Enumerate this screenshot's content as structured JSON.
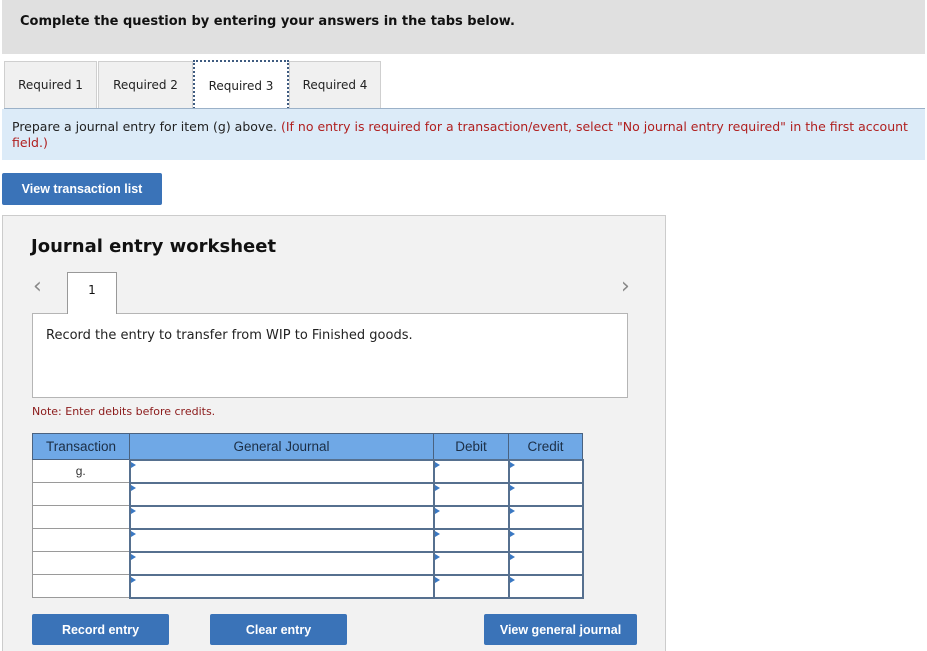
{
  "header": {
    "title": "Complete the question by entering your answers in the tabs below."
  },
  "tabs": [
    {
      "label": "Required 1",
      "active": false
    },
    {
      "label": "Required 2",
      "active": false
    },
    {
      "label": "Required 3",
      "active": true
    },
    {
      "label": "Required 4",
      "active": false
    }
  ],
  "instructions": {
    "main": "Prepare a journal entry for item (g) above.",
    "note": "(If no entry is required for a transaction/event, select \"No journal entry required\" in the first account field.)"
  },
  "view_transaction_list_label": "View transaction list",
  "worksheet": {
    "title": "Journal entry worksheet",
    "prev_icon": "chevron-left-icon",
    "next_icon": "chevron-right-icon",
    "entry_tab": "1",
    "description": "Record the entry to transfer from WIP to Finished goods.",
    "note": "Note: Enter debits before credits.",
    "columns": [
      "Transaction",
      "General Journal",
      "Debit",
      "Credit"
    ],
    "rows": [
      {
        "transaction": "g.",
        "account": "",
        "debit": "",
        "credit": ""
      },
      {
        "transaction": "",
        "account": "",
        "debit": "",
        "credit": ""
      },
      {
        "transaction": "",
        "account": "",
        "debit": "",
        "credit": ""
      },
      {
        "transaction": "",
        "account": "",
        "debit": "",
        "credit": ""
      },
      {
        "transaction": "",
        "account": "",
        "debit": "",
        "credit": ""
      },
      {
        "transaction": "",
        "account": "",
        "debit": "",
        "credit": ""
      }
    ],
    "buttons": {
      "record": "Record entry",
      "clear": "Clear entry",
      "view_journal": "View general journal"
    }
  },
  "colors": {
    "accent": "#3a73b8",
    "header_cell": "#6fa8e6",
    "instruction_bg": "#dcebf8",
    "warning_text": "#b02020"
  }
}
